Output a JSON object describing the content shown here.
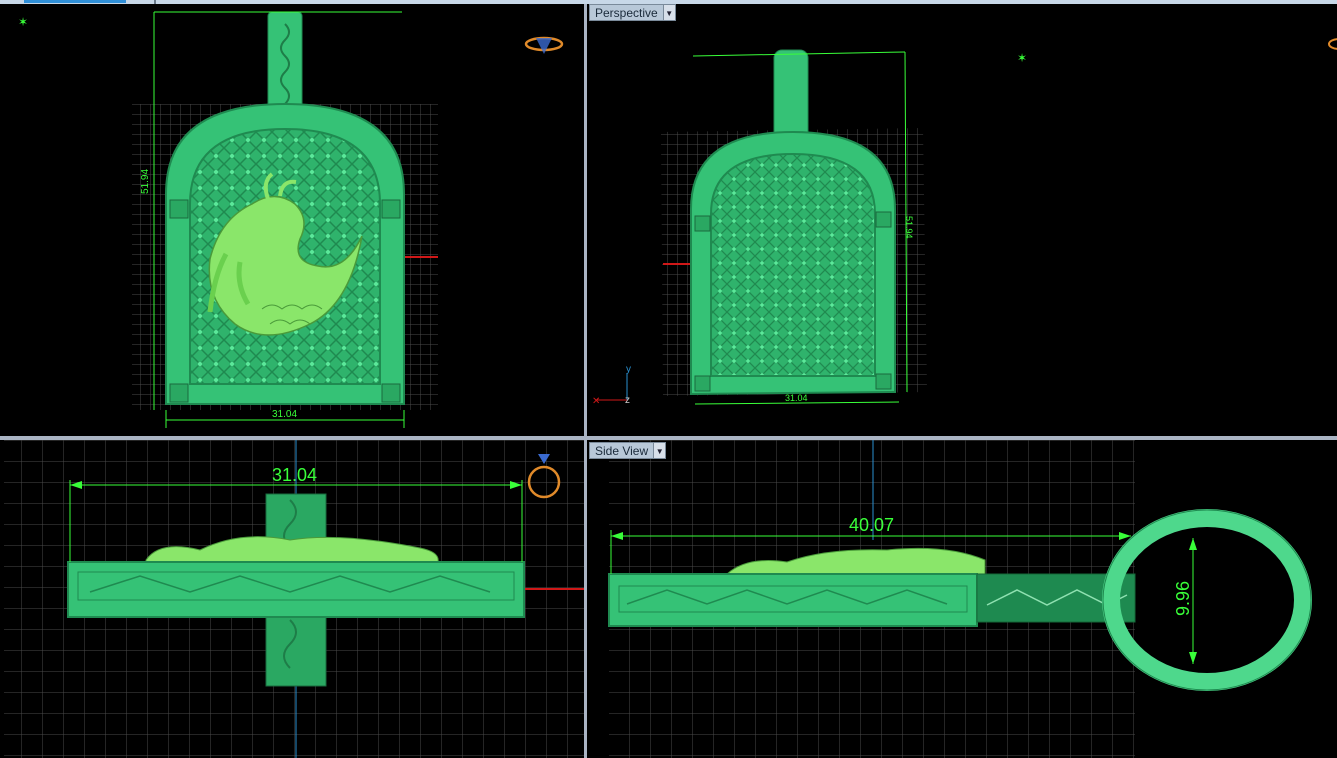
{
  "viewports": {
    "top_left": {
      "dim_height": "51.94",
      "dim_width": "31.04"
    },
    "top_right": {
      "label": "Perspective",
      "dim_height": "51.94",
      "dim_width": "31.04",
      "axis_y": "y",
      "axis_z": "z"
    },
    "bottom_left": {
      "dim_width": "31.04"
    },
    "bottom_right": {
      "label": "Side View",
      "dim_length": "40.07",
      "dim_bail": "9.96"
    }
  },
  "colors": {
    "background": "#000000",
    "model": "#3fd584",
    "dimension": "#39ff39",
    "grid": "#4a4a4a",
    "axis_red": "#d01818",
    "axis_blue": "#2a90d0",
    "gizmo_orange": "#e08a2a"
  },
  "icons": [
    "ring-gizmo-icon",
    "view-dropdown-icon",
    "axis-marker-icon"
  ]
}
